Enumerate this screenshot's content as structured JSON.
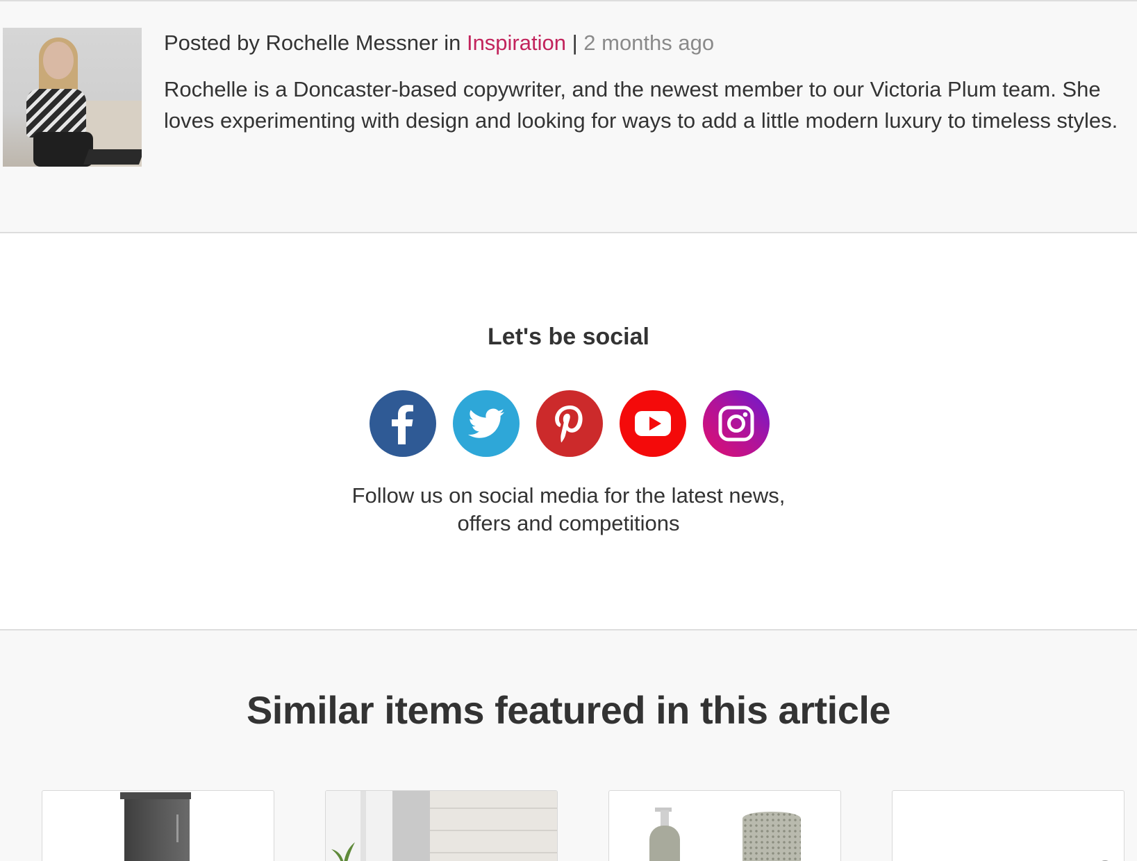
{
  "author": {
    "posted_by_prefix": "Posted by ",
    "name": "Rochelle Messner",
    "in_word": " in ",
    "category": "Inspiration",
    "separator": " | ",
    "time_ago": "2 months ago",
    "bio": "Rochelle is a Doncaster-based copywriter, and the newest member to our Victoria Plum team. She loves experimenting with design and looking for ways to add a little modern luxury to timeless styles."
  },
  "social": {
    "title": "Let's be social",
    "text_line1": "Follow us on social media for the latest news,",
    "text_line2": "offers and competitions",
    "icons": [
      {
        "name": "facebook-icon",
        "color": "#2f5a95"
      },
      {
        "name": "twitter-icon",
        "color": "#2ea7d8"
      },
      {
        "name": "pinterest-icon",
        "color": "#cc2a2b"
      },
      {
        "name": "youtube-icon",
        "color": "#f40a0a"
      },
      {
        "name": "instagram-icon",
        "color": "#b0139a"
      }
    ]
  },
  "similar": {
    "title": "Similar items featured in this article"
  },
  "colors": {
    "accent": "#c2245c",
    "text": "#333333",
    "muted": "#8a8a8a"
  }
}
